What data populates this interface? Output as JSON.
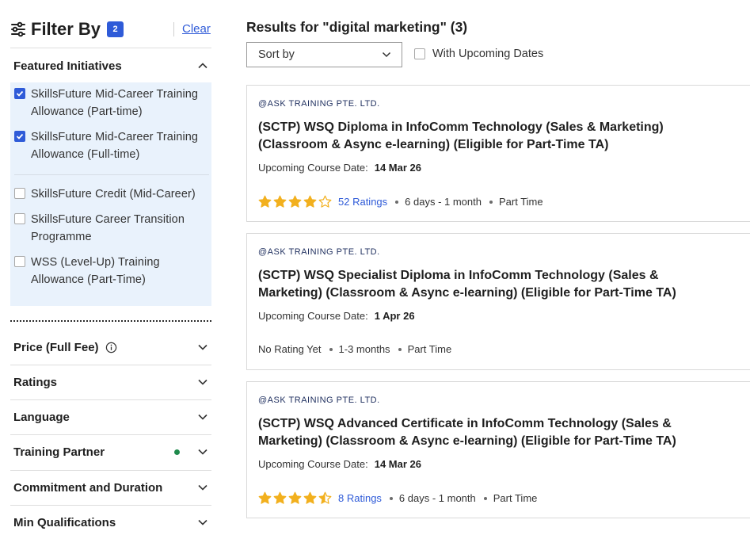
{
  "sidebar": {
    "title": "Filter By",
    "count": "2",
    "clear_label": "Clear",
    "featured": {
      "label": "Featured Initiatives",
      "options": [
        {
          "label": "SkillsFuture Mid-Career Training Allowance (Part-time)",
          "checked": true
        },
        {
          "label": "SkillsFuture Mid-Career Training Allowance (Full-time)",
          "checked": true
        },
        {
          "label": "SkillsFuture Credit (Mid-Career)",
          "checked": false
        },
        {
          "label": "SkillsFuture Career Transition Programme",
          "checked": false
        },
        {
          "label": "WSS (Level-Up) Training Allowance (Part-Time)",
          "checked": false
        }
      ]
    },
    "sections": [
      {
        "label": "Price (Full Fee)",
        "info": true
      },
      {
        "label": "Ratings"
      },
      {
        "label": "Language"
      },
      {
        "label": "Training Partner",
        "indicator": true
      },
      {
        "label": "Commitment and Duration"
      },
      {
        "label": "Min Qualifications"
      }
    ]
  },
  "main": {
    "results_title": "Results for \"digital marketing\" (3)",
    "sort_label": "Sort by",
    "upcoming_label": "With Upcoming Dates",
    "date_label": "Upcoming Course Date:",
    "courses": [
      {
        "provider": "@ASK TRAINING PTE. LTD.",
        "title": "(SCTP) WSQ Diploma in InfoComm Technology (Sales & Marketing) (Classroom & Async e-learning) (Eligible for Part-Time TA)",
        "date": "14 Mar 26",
        "rating": 4.0,
        "ratings_text": "52 Ratings",
        "duration": "6 days - 1 month",
        "mode": "Part Time"
      },
      {
        "provider": "@ASK TRAINING PTE. LTD.",
        "title": "(SCTP) WSQ Specialist Diploma in InfoComm Technology (Sales & Marketing) (Classroom & Async e-learning) (Eligible for Part-Time TA)",
        "date": "1 Apr 26",
        "rating": null,
        "ratings_text": "No Rating Yet",
        "duration": "1-3 months",
        "mode": "Part Time"
      },
      {
        "provider": "@ASK TRAINING PTE. LTD.",
        "title": "(SCTP) WSQ Advanced Certificate in InfoComm Technology (Sales & Marketing) (Classroom & Async e-learning) (Eligible for Part-Time TA)",
        "date": "14 Mar 26",
        "rating": 4.5,
        "ratings_text": "8 Ratings",
        "duration": "6 days - 1 month",
        "mode": "Part Time"
      }
    ]
  },
  "colors": {
    "accent": "#2f5bd8",
    "star": "#f2b01e",
    "panel_bg": "#e9f2fc",
    "indicator": "#1f8a4c"
  },
  "icons": [
    "sliders-icon",
    "chevron-up-icon",
    "chevron-down-icon",
    "info-icon",
    "star-icon",
    "check-icon"
  ]
}
